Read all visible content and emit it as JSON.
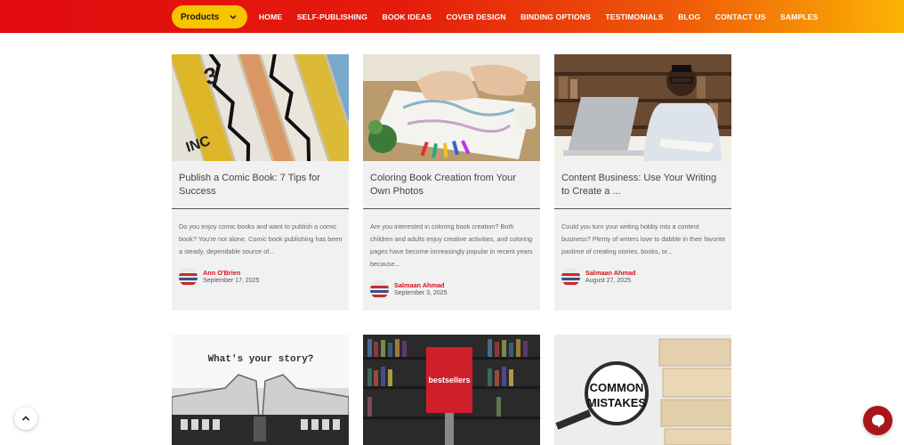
{
  "header": {
    "products_label": "Products",
    "nav": [
      "HOME",
      "SELF-PUBLISHING",
      "BOOK IDEAS",
      "COVER DESIGN",
      "BINDING OPTIONS",
      "TESTIMONIALS",
      "BLOG",
      "CONTACT US",
      "SAMPLES"
    ]
  },
  "posts": [
    {
      "title": "Publish a Comic Book: 7 Tips for Success",
      "excerpt": "Do you enjoy comic books and want to publish a comic book? You're not alone. Comic book publishing has been a steady, dependable source of...",
      "author": "Ann O'Brien",
      "date": "September 17, 2025"
    },
    {
      "title": "Coloring Book Creation from Your Own Photos",
      "excerpt": "Are you interested in coloring book creation? Both children and adults enjoy creative activities, and coloring pages have become increasingly popular in recent years because...",
      "author": "Salmaan Ahmad",
      "date": "September 3, 2025"
    },
    {
      "title": "Content Business: Use Your Writing to Create a ...",
      "excerpt": "Could you turn your writing hobby into a content business? Plenty of writers love to dabble in their favorite pastime of creating stories, books, or...",
      "author": "Salmaan Ahmad",
      "date": "August 27, 2025"
    }
  ],
  "row2": {
    "typewriter_text": "What's your story?",
    "bestsellers_text": "bestsellers",
    "mistakes_line1": "COMMON",
    "mistakes_line2": "MISTAKES"
  },
  "icons": {
    "products_chevron": "chevron-down-icon",
    "scroll_top": "chevron-up-icon",
    "chat": "chat-bubble-icon"
  },
  "colors": {
    "accent_red": "#e10a10",
    "accent_yellow": "#f6c500",
    "author_red": "#d6111b",
    "chat_red": "#a8151b"
  }
}
